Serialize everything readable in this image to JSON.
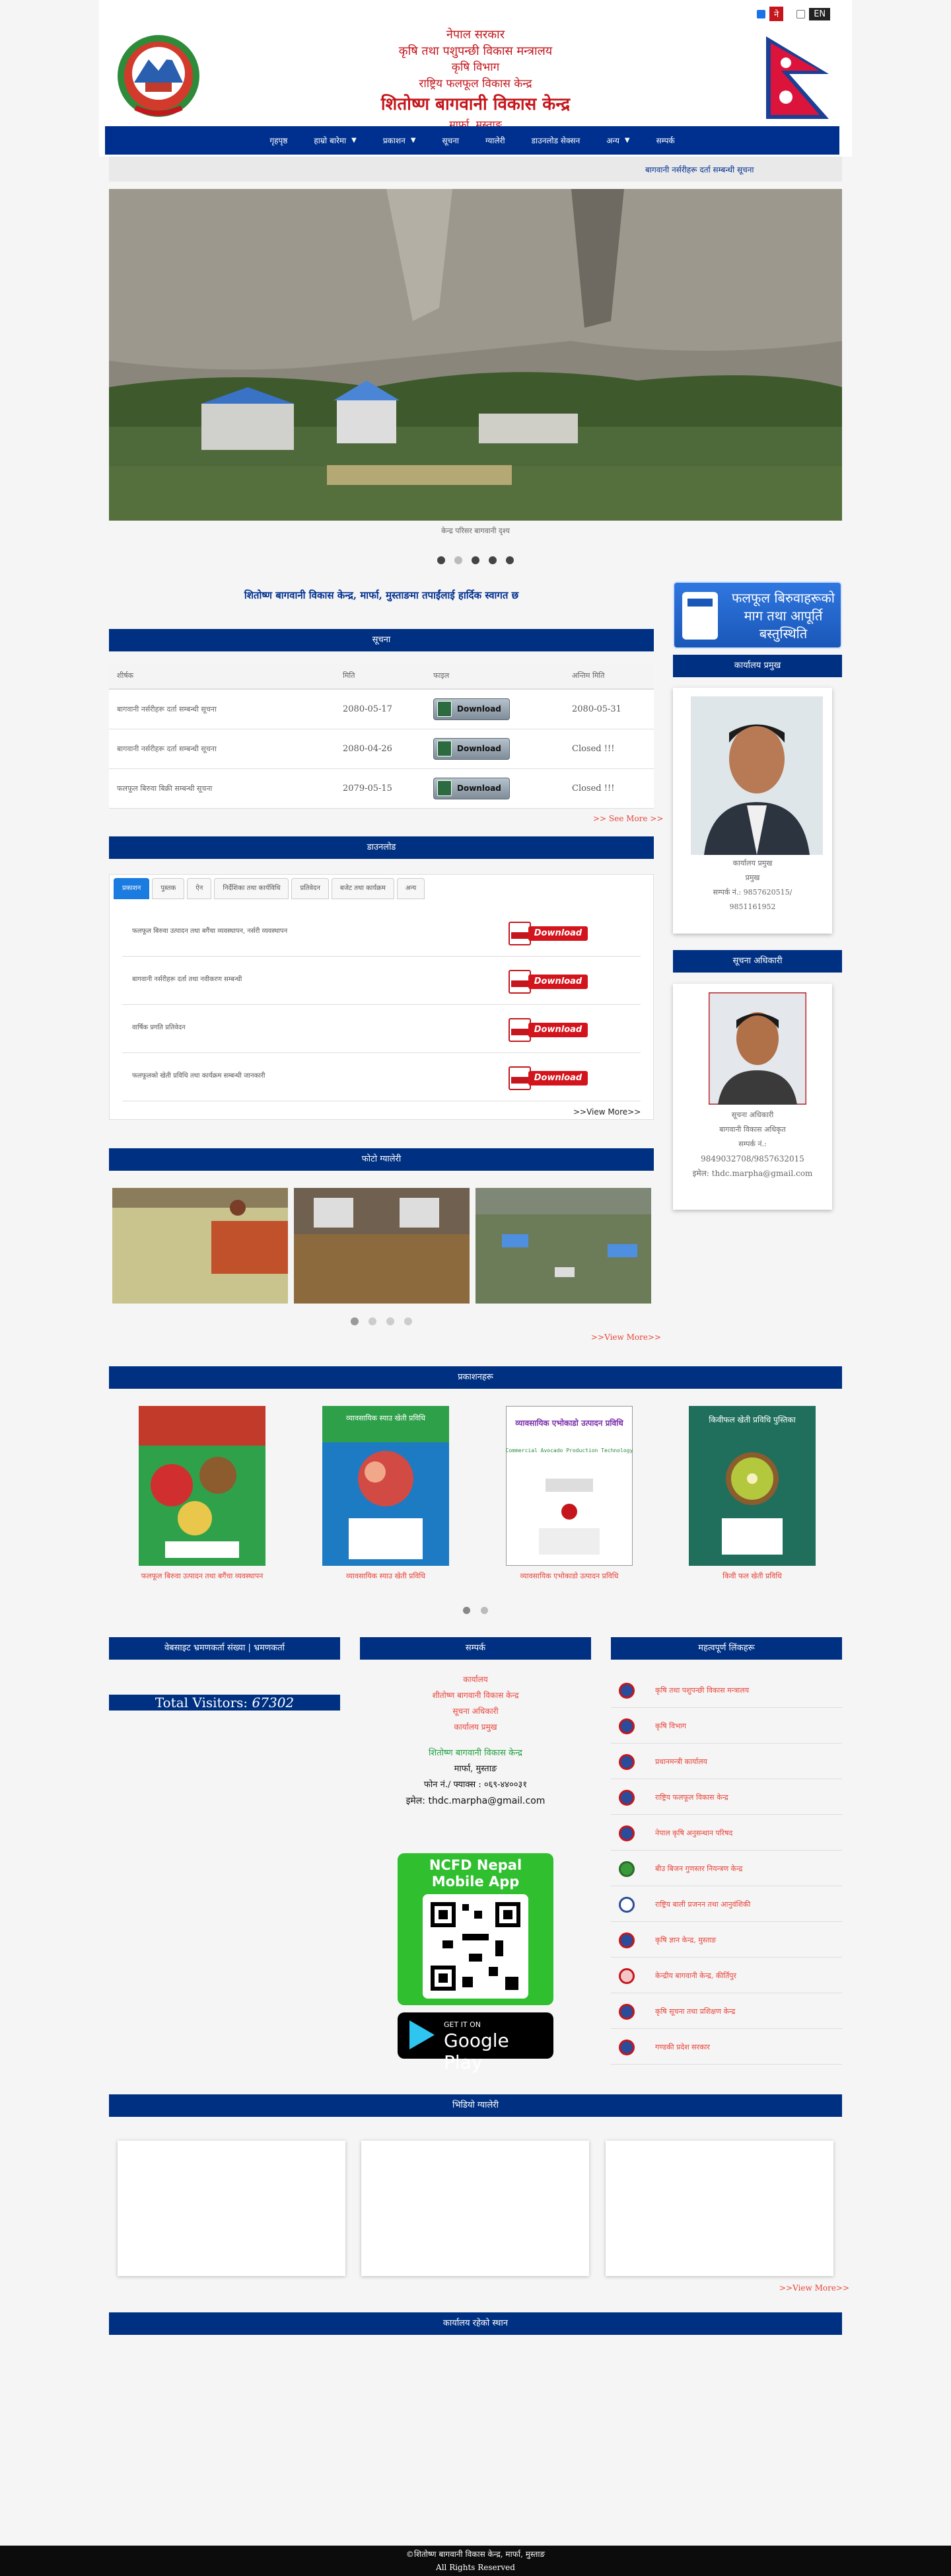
{
  "lang": {
    "np": "ने",
    "en": "EN"
  },
  "header": {
    "line1": "नेपाल सरकार",
    "line2": "कृषि तथा पशुपन्छी विकास मन्त्रालय",
    "line3": "कृषि विभाग",
    "line4": "राष्ट्रिय फलफूल विकास केन्द्र",
    "line5": "शितोष्ण बागवानी विकास केन्द्र",
    "line6": "मार्फा, मुस्ताङ"
  },
  "nav": [
    {
      "label": "गृहपृष्ठ",
      "dropdown": false
    },
    {
      "label": "हाम्रो बारेमा",
      "dropdown": true
    },
    {
      "label": "प्रकाशन",
      "dropdown": true
    },
    {
      "label": "सूचना",
      "dropdown": false
    },
    {
      "label": "ग्यालेरी",
      "dropdown": false
    },
    {
      "label": "डाउनलोड सेक्सन",
      "dropdown": false
    },
    {
      "label": "अन्य",
      "dropdown": true
    },
    {
      "label": "सम्पर्क",
      "dropdown": false
    }
  ],
  "ticker": "बागवानी नर्सरीहरू दर्ता सम्बन्धी सूचना",
  "slider": {
    "caption": "केन्द्र परिसर बागवानी दृश्य"
  },
  "welcome": "शितोष्ण बागवानी विकास केन्द्र, मार्फा, मुस्ताङमा तपाईंलाई हार्दिक स्वागत छ",
  "notices": {
    "title": "सूचना",
    "headers": [
      "शीर्षक",
      "मिति",
      "फाइल",
      "अन्तिम मिति"
    ],
    "download_label": "Download",
    "rows": [
      {
        "title": "बागवानी नर्सरीहरू दर्ता सम्बन्धी सूचना",
        "date": "2080-05-17",
        "deadline": "2080-05-31"
      },
      {
        "title": "बागवानी नर्सरीहरू दर्ता सम्बन्धी सूचना",
        "date": "2080-04-26",
        "deadline": "Closed !!!"
      },
      {
        "title": "फलफूल बिरुवा बिक्री सम्बन्धी सूचना",
        "date": "2079-05-15",
        "deadline": "Closed !!!"
      }
    ],
    "see_more": ">> See More >>"
  },
  "downloads": {
    "title": "डाउनलोड",
    "tabs": [
      "प्रकाशन",
      "पुस्तक",
      "ऐन",
      "निर्देशिका तथा कार्यविधि",
      "प्रतिवेदन",
      "बजेट तथा कार्यक्रम",
      "अन्य"
    ],
    "button_label": "Download",
    "rows": [
      {
        "title": "फलफूल बिरुवा उत्पादन तथा बगैंचा व्यवस्थापन, नर्सरी व्यवस्थापन"
      },
      {
        "title": "बागवानी नर्सरीहरू दर्ता तथा नवीकरण सम्बन्धी"
      },
      {
        "title": "वार्षिक प्रगति प्रतिवेदन"
      },
      {
        "title": "फलफूलको खेती प्रविधि तथा कार्यक्रम सम्बन्धी जानकारी"
      }
    ],
    "view_more": ">>View More>>"
  },
  "gallery": {
    "title": "फोटो ग्यालेरी",
    "view_more": ">>View More>>"
  },
  "publications": {
    "title": "प्रकाशनहरू",
    "books": [
      {
        "caption": "फलफूल बिरुवा उत्पादन तथा बगैंचा व्यवस्थापन"
      },
      {
        "caption": "व्यावसायिक स्याउ खेती प्रविधि"
      },
      {
        "caption": "व्यावसायिक एभोकाडो उत्पादन प्रविधि"
      },
      {
        "caption": "किवी फल खेती प्रविधि"
      }
    ],
    "book_titles": [
      "",
      "व्यावसायिक स्याउ खेती प्रविधि",
      "व्यावसायिक एभोकाडो उत्पादन प्रविधि",
      "किवीफल खेती प्रविधि पुस्तिका"
    ],
    "book_sub": [
      "",
      "",
      "[Commercial Avocado Production Technology]",
      ""
    ]
  },
  "banner": {
    "line1": "फलफूल बिरुवाहरूको",
    "line2": "माग तथा आपूर्ति",
    "line3": "बस्तुस्थिति"
  },
  "chief": {
    "title": "कार्यालय प्रमुख",
    "name": "कार्यालय प्रमुख",
    "role": "प्रमुख",
    "phone": "सम्पर्क नं.: 9857620515/",
    "phone2": "9851161952"
  },
  "info_officer": {
    "title": "सूचना अधिकारी",
    "name": "सूचना अधिकारी",
    "role": "बागवानी विकास अधिकृत",
    "phone_label": "सम्पर्क नं.:",
    "phone": "9849032708/9857632015",
    "email": "इमेल: thdc.marpha@gmail.com"
  },
  "visitors": {
    "title": "वेबसाइट भ्रमणकर्ता संख्या | भ्रमणकर्ता",
    "label": "Total Visitors:",
    "count": "67302"
  },
  "contact": {
    "title": "सम्पर्क",
    "lines": [
      "कार्यालय",
      "शीतोष्ण बागवानी विकास केन्द्र",
      "सूचना अधिकारी",
      "कार्यालय प्रमुख"
    ],
    "office": "शितोष्ण बागवानी विकास केन्द्र",
    "address": "मार्फा, मुस्ताङ",
    "phone": "फोन नं./ फ्याक्स : ०६९-४४००३१",
    "email_label": "इमेल: thdc.marpha@gmail.com"
  },
  "app": {
    "title1": "NCFD Nepal",
    "title2": "Mobile App",
    "gplay_small": "GET IT ON",
    "gplay_big": "Google Play"
  },
  "links": {
    "title": "महत्वपूर्ण लिंकहरू",
    "items": [
      "कृषि तथा पशुपन्छी विकास मन्त्रालय",
      "कृषि विभाग",
      "प्रधानमन्त्री कार्यालय",
      "राष्ट्रिय फलफूल विकास केन्द्र",
      "नेपाल कृषि अनुसन्धान परिषद",
      "बीउ बिजन गुणस्तर नियन्त्रण केन्द्र",
      "राष्ट्रिय बाली प्रजनन तथा आनुवंशिकी",
      "कृषि ज्ञान केन्द्र, मुस्ताङ",
      "केन्द्रीय बागवानी केन्द्र, कीर्तिपुर",
      "कृषि सूचना तथा प्रशिक्षण केन्द्र",
      "गण्डकी प्रदेश सरकार"
    ]
  },
  "videos": {
    "title": "भिडियो ग्यालेरी",
    "view_more": ">>View More>>"
  },
  "map": {
    "title": "कार्यालय रहेको स्थान"
  },
  "footer": {
    "line1": "©शितोष्ण बागवानी विकास केन्द्र, मार्फा, मुस्ताङ",
    "line2": "All Rights Reserved"
  }
}
